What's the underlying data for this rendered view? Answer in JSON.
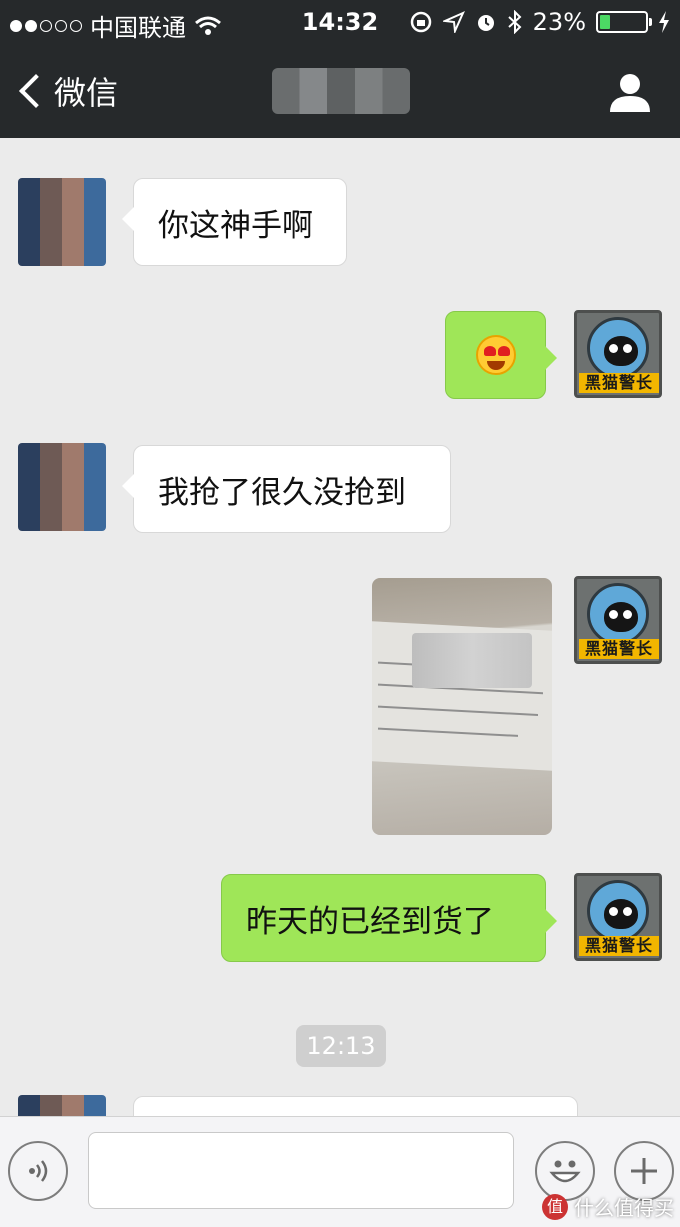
{
  "status_bar": {
    "carrier": "中国联通",
    "time": "14:32",
    "battery": "23%",
    "battery_level": 0.23
  },
  "nav": {
    "back_label": "微信"
  },
  "messages": [
    {
      "text": "你这神手啊"
    },
    {
      "emoji": "heart-eyes-emoji"
    },
    {
      "text": "我抢了很久没抢到"
    },
    {
      "photo": "receipt-photo"
    },
    {
      "text": "昨天的已经到货了"
    }
  ],
  "timestamp": "12:13",
  "avatar_label": "黑猫警长",
  "colors": {
    "nav_bg": "#26292b",
    "chat_bg": "#ebebeb",
    "outgoing_bubble": "#9fe658",
    "incoming_bubble": "#ffffff"
  },
  "watermark": "什么值得买"
}
